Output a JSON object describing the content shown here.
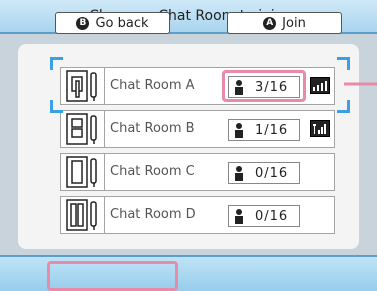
{
  "header": {
    "title": "Choose a Chat Room to join."
  },
  "rooms": [
    {
      "name": "Chat Room A",
      "count": "3/16",
      "signal_icon": "signal-strength-icon"
    },
    {
      "name": "Chat Room B",
      "count": "1/16",
      "signal_icon": "signal-strength-icon"
    },
    {
      "name": "Chat Room C",
      "count": "0/16"
    },
    {
      "name": "Chat Room D",
      "count": "0/16"
    }
  ],
  "footer": {
    "back": {
      "glyph": "B",
      "label": "Go back"
    },
    "join": {
      "glyph": "A",
      "label": "Join"
    }
  },
  "colors": {
    "header_bg": "#bfe3f6",
    "accent": "#3aa0e3",
    "highlight": "#e88aa8",
    "panel_bg": "#f4f4f4"
  }
}
